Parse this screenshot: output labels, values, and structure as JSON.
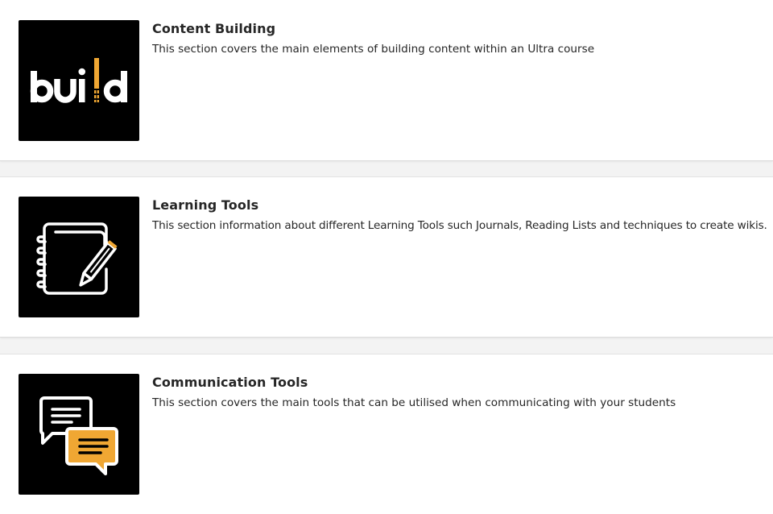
{
  "colors": {
    "accent": "#f0a733",
    "thumb_background": "#000000",
    "text": "#262626"
  },
  "items": [
    {
      "title": "Content Building",
      "description": "This section covers the main elements of building content within an Ultra course",
      "icon": "build-logo-icon",
      "logo_text": "build"
    },
    {
      "title": "Learning Tools",
      "description": "This section information about different Learning Tools such Journals, Reading Lists and techniques to create wikis.",
      "icon": "notebook-pencil-icon"
    },
    {
      "title": "Communication Tools",
      "description": "This section covers the main tools that can be utilised when communicating with your students",
      "icon": "chat-bubbles-icon"
    }
  ]
}
